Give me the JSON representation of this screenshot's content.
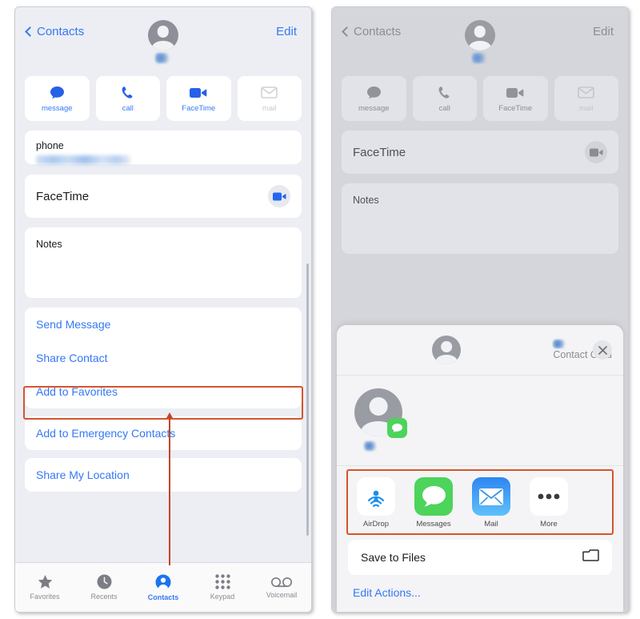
{
  "left_panel": {
    "nav": {
      "back_label": "Contacts",
      "edit_label": "Edit"
    },
    "quick_actions": [
      {
        "label": "message",
        "icon": "message-bubble-icon",
        "enabled": true
      },
      {
        "label": "call",
        "icon": "phone-handset-icon",
        "enabled": true
      },
      {
        "label": "FaceTime",
        "icon": "video-camera-icon",
        "enabled": true
      },
      {
        "label": "mail",
        "icon": "envelope-icon",
        "enabled": false
      }
    ],
    "phone_field": {
      "label": "phone",
      "value": ""
    },
    "facetime_row": {
      "label": "FaceTime",
      "icon": "video-camera-icon"
    },
    "notes_card": {
      "label": "Notes",
      "value": ""
    },
    "actions_group_1": [
      "Send Message",
      "Share Contact",
      "Add to Favorites"
    ],
    "actions_group_2": [
      "Add to Emergency Contacts"
    ],
    "actions_group_3": [
      "Share My Location"
    ],
    "highlighted_action": "Share Contact",
    "tabbar": [
      {
        "label": "Favorites",
        "icon": "star-icon",
        "active": false
      },
      {
        "label": "Recents",
        "icon": "clock-icon",
        "active": false
      },
      {
        "label": "Contacts",
        "icon": "person-circle-icon",
        "active": true
      },
      {
        "label": "Keypad",
        "icon": "keypad-grid-icon",
        "active": false
      },
      {
        "label": "Voicemail",
        "icon": "voicemail-icon",
        "active": false
      }
    ]
  },
  "right_panel": {
    "dimmed": true,
    "nav": {
      "back_label": "Contacts",
      "edit_label": "Edit"
    },
    "quick_actions": [
      {
        "label": "message",
        "icon": "message-bubble-icon",
        "enabled": true
      },
      {
        "label": "call",
        "icon": "phone-handset-icon",
        "enabled": true
      },
      {
        "label": "FaceTime",
        "icon": "video-camera-icon",
        "enabled": true
      },
      {
        "label": "mail",
        "icon": "envelope-icon",
        "enabled": false
      }
    ],
    "facetime_row": {
      "label": "FaceTime",
      "icon": "video-camera-icon"
    },
    "notes_card": {
      "label": "Notes",
      "value": ""
    },
    "share_sheet": {
      "header_title": "Contact Card",
      "close_icon": "close-x-icon",
      "targets": [
        {
          "label": "AirDrop",
          "icon": "airdrop-icon"
        },
        {
          "label": "Messages",
          "icon": "messages-icon"
        },
        {
          "label": "Mail",
          "icon": "mail-icon"
        },
        {
          "label": "More",
          "icon": "more-dots-icon"
        }
      ],
      "save_to_files": {
        "label": "Save to Files",
        "icon": "folder-icon"
      },
      "edit_actions_label": "Edit Actions..."
    }
  },
  "colors": {
    "accent_blue": "#3478f6",
    "highlight_red": "#d4552e",
    "messages_green": "#4cd45b",
    "mail_blue": "#3b9cf0",
    "panel_bg": "#eceef3",
    "card_white": "#ffffff",
    "dim_overlay": "#d5d6db"
  }
}
